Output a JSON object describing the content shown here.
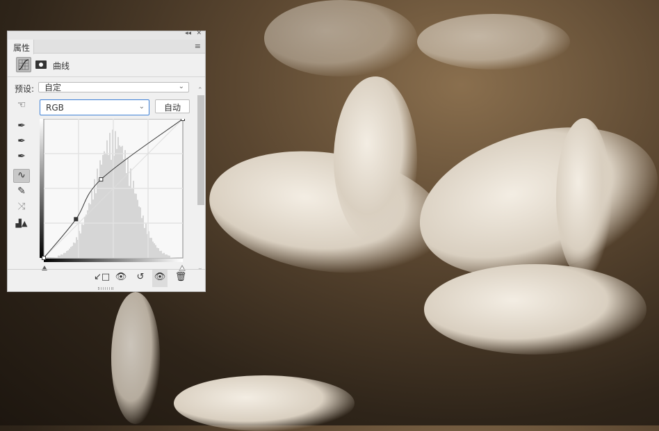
{
  "panel": {
    "tab": "属性",
    "title": "曲线",
    "preset_label": "预设:",
    "preset_value": "自定",
    "channel": "RGB",
    "auto_button": "自动",
    "collapse": "◂◂",
    "close": "✕",
    "menu": "≡"
  },
  "curve": {
    "points": [
      [
        0,
        0
      ],
      [
        59,
        71
      ],
      [
        105,
        144
      ],
      [
        255,
        255
      ]
    ],
    "input_range": [
      0,
      255
    ]
  },
  "colors": {
    "accent": "#3c7fd6",
    "panel_bg": "#f0f0f0"
  }
}
